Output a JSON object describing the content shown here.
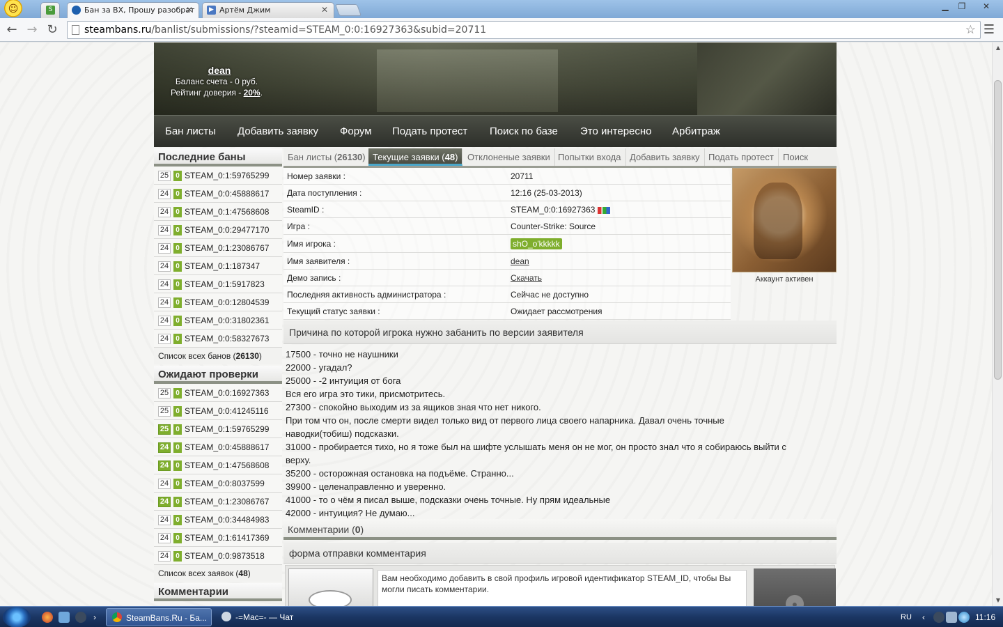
{
  "browser": {
    "tabs": [
      {
        "title": "",
        "favicon": "steambans-icon"
      },
      {
        "title": "Бан за ВХ, Прошу разобрат",
        "favicon": "globe-icon"
      },
      {
        "title": "Артём Джим",
        "favicon": "play-icon"
      }
    ],
    "url_host": "steambans.ru",
    "url_path": "/banlist/submissions/?steamid=STEAM_0:0:16927363&subid=20711"
  },
  "header": {
    "username": "dean",
    "balance": "Баланс счета - 0 руб.",
    "rating_label": "Рейтинг доверия - ",
    "rating_value": "20%",
    "rating_suffix": "."
  },
  "nav": [
    "Бан листы",
    "Добавить заявку",
    "Форум",
    "Подать протест",
    "Поиск по базе",
    "Это интересно",
    "Арбитраж"
  ],
  "sidebar": {
    "recent_title": "Последние баны",
    "recent": [
      {
        "count": "25",
        "steamid": "STEAM_0:1:59765299"
      },
      {
        "count": "24",
        "steamid": "STEAM_0:0:45888617"
      },
      {
        "count": "24",
        "steamid": "STEAM_0:1:47568608"
      },
      {
        "count": "24",
        "steamid": "STEAM_0:0:29477170"
      },
      {
        "count": "24",
        "steamid": "STEAM_0:1:23086767"
      },
      {
        "count": "24",
        "steamid": "STEAM_0:1:187347"
      },
      {
        "count": "24",
        "steamid": "STEAM_0:1:5917823"
      },
      {
        "count": "24",
        "steamid": "STEAM_0:0:12804539"
      },
      {
        "count": "24",
        "steamid": "STEAM_0:0:31802361"
      },
      {
        "count": "24",
        "steamid": "STEAM_0:0:58327673"
      }
    ],
    "recent_all_label": "Список всех банов (",
    "recent_all_count": "26130",
    "recent_all_suffix": ")",
    "pending_title": "Ожидают проверки",
    "pending": [
      {
        "count": "25",
        "steamid": "STEAM_0:0:16927363",
        "highlight": false
      },
      {
        "count": "25",
        "steamid": "STEAM_0:0:41245116",
        "highlight": false
      },
      {
        "count": "25",
        "steamid": "STEAM_0:1:59765299",
        "highlight": true
      },
      {
        "count": "24",
        "steamid": "STEAM_0:0:45888617",
        "highlight": true
      },
      {
        "count": "24",
        "steamid": "STEAM_0:1:47568608",
        "highlight": true
      },
      {
        "count": "24",
        "steamid": "STEAM_0:0:8037599",
        "highlight": false
      },
      {
        "count": "24",
        "steamid": "STEAM_0:1:23086767",
        "highlight": true
      },
      {
        "count": "24",
        "steamid": "STEAM_0:0:34484983",
        "highlight": false
      },
      {
        "count": "24",
        "steamid": "STEAM_0:1:61417369",
        "highlight": false
      },
      {
        "count": "24",
        "steamid": "STEAM_0:0:9873518",
        "highlight": false
      }
    ],
    "pending_all_label": "Список всех заявок (",
    "pending_all_count": "48",
    "pending_all_suffix": ")",
    "comments_title": "Комментарии",
    "zero_badge": "0"
  },
  "subtabs": [
    {
      "label": "Бан листы (",
      "count": "26130",
      "suffix": ")"
    },
    {
      "label": "Текущие заявки (",
      "count": "48",
      "suffix": ")"
    },
    {
      "label": "Отклоненые заявки",
      "count": "",
      "suffix": ""
    },
    {
      "label": "Попытки входа",
      "count": "",
      "suffix": ""
    },
    {
      "label": "Добавить заявку",
      "count": "",
      "suffix": ""
    },
    {
      "label": "Подать протест",
      "count": "",
      "suffix": ""
    },
    {
      "label": "Поиск",
      "count": "",
      "suffix": ""
    }
  ],
  "submission": {
    "rows": [
      {
        "label": "Номер заявки :",
        "value": "20711"
      },
      {
        "label": "Дата поступления :",
        "value": "12:16 (25-03-2013)"
      },
      {
        "label": "SteamID :",
        "value": "STEAM_0:0:16927363"
      },
      {
        "label": "Игра :",
        "value": "Counter-Strike: Source"
      },
      {
        "label": "Имя игрока :",
        "value": "shO_o'kkkkk"
      },
      {
        "label": "Имя заявителя :",
        "value": "dean"
      },
      {
        "label": "Демо запись :",
        "value": "Скачать"
      },
      {
        "label": "Последняя активность администратора :",
        "value": "Сейчас не доступно"
      },
      {
        "label": "Текущий статус заявки :",
        "value": "Ожидает рассмотрения"
      }
    ],
    "avatar_status": "Аккаунт активен"
  },
  "reason": {
    "title": "Причина по которой игрока нужно забанить по версии заявителя",
    "lines": [
      "17500 - точно не наушники",
      "22000 - угадал?",
      "25000 - -2 интуиция от бога",
      "Вся его игра это тики, присмотритесь.",
      "27300 - спокойно выходим из за ящиков зная что нет никого.",
      "При том что он, после смерти видел только вид от первого лица своего напарника. Давал очень точные",
      "наводки(тобиш) подсказки.",
      "31000 - пробирается тихо, но я тоже был на шифте услышать меня он не мог, он просто знал что я собираюсь выйти с",
      "верху.",
      "35200 - осторожная остановка на подъёме. Странно...",
      "39900 - целенаправленно и уверенно.",
      "41000 - то о чём я писал выше, подсказки очень точные. Ну прям идеальные",
      "42000 - интуиция? Не думаю..."
    ]
  },
  "comments": {
    "label": "Комментарии (",
    "count": "0",
    "suffix": ")",
    "form_title": "форма отправки комментария",
    "message": "Вам необходимо добавить в свой профиль игровой идентификатор STEAM_ID, чтобы Вы могли писать комментарии."
  },
  "taskbar": {
    "window1": "SteamBans.Ru - Ба...",
    "window2": "-=Mac=- — Чат",
    "lang": "RU",
    "clock": "11:16"
  }
}
